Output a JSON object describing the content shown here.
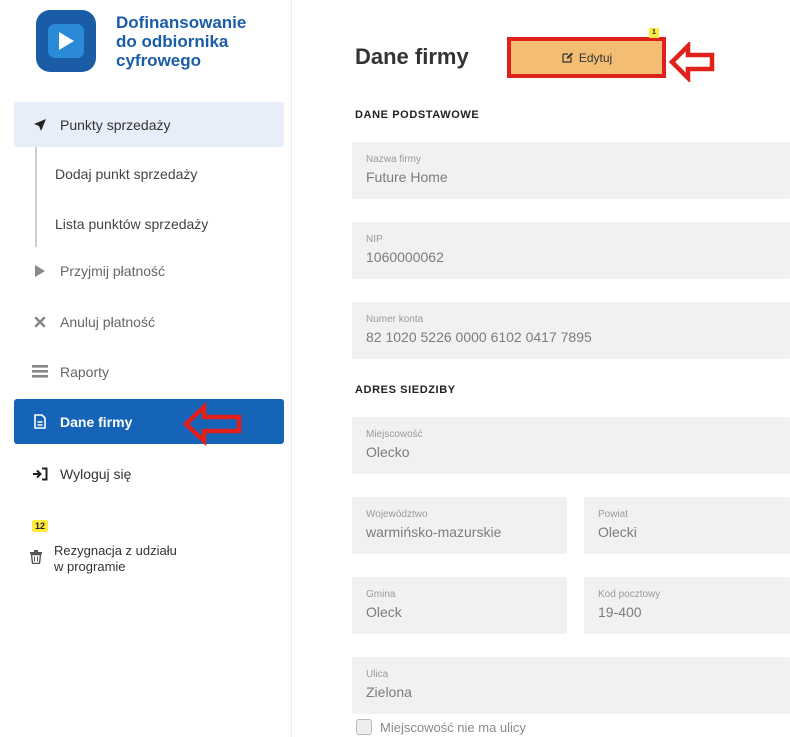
{
  "brand": {
    "line1": "Dofinansowanie",
    "line2": "do odbiornika",
    "line3": "cyfrowego"
  },
  "sidebar": {
    "items": [
      {
        "label": "Punkty sprzedaży",
        "icon": "paper-plane-icon",
        "state": "selected"
      },
      {
        "label": "Dodaj punkt sprzedaży",
        "state": "sub"
      },
      {
        "label": "Lista punktów sprzedaży",
        "state": "sub"
      },
      {
        "label": "Przyjmij płatność",
        "icon": "play-icon",
        "state": "normal"
      },
      {
        "label": "Anuluj płatność",
        "icon": "times-icon",
        "state": "normal"
      },
      {
        "label": "Raporty",
        "icon": "list-icon",
        "state": "normal"
      },
      {
        "label": "Dane firmy",
        "icon": "document-icon",
        "state": "active"
      },
      {
        "label": "Wyloguj się",
        "icon": "sign-out-icon",
        "state": "normal"
      }
    ],
    "resign_badge": "12",
    "resign_line1": "Rezygnacja z udziału",
    "resign_line2": "w programie"
  },
  "main": {
    "title": "Dane firmy",
    "edit_label": "Edytuj",
    "edit_badge": "1",
    "section_basic": "DANE PODSTAWOWE",
    "section_address": "ADRES SIEDZIBY",
    "fields": {
      "company_name": {
        "label": "Nazwa firmy",
        "value": "Future Home"
      },
      "nip": {
        "label": "NIP",
        "value": "1060000062"
      },
      "account": {
        "label": "Numer konta",
        "value": "82 1020 5226 0000 6102 0417 7895"
      },
      "city": {
        "label": "Miejscowość",
        "value": "Olecko"
      },
      "voivodeship": {
        "label": "Województwo",
        "value": "warmińsko-mazurskie"
      },
      "county": {
        "label": "Powiat",
        "value": "Olecki"
      },
      "commune": {
        "label": "Gmina",
        "value": "Oleck"
      },
      "postal_code": {
        "label": "Kod pocztowy",
        "value": "19-400"
      },
      "street": {
        "label": "Ulica",
        "value": "Zielona"
      }
    },
    "no_street_label": "Miejscowość nie ma ulicy"
  },
  "colors": {
    "brand": "#1a5da6",
    "active_nav": "#1564b8",
    "edit_button": "#f3bd74",
    "annotation_red": "#e0201b",
    "badge_yellow": "#ffeb3b"
  }
}
